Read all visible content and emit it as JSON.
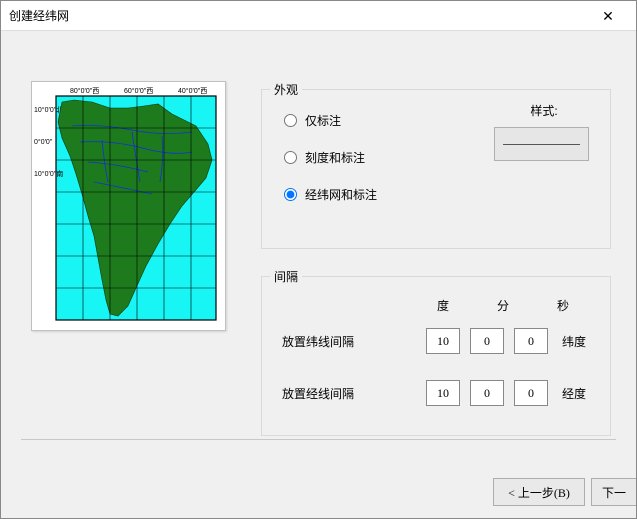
{
  "window": {
    "title": "创建经纬网",
    "close_glyph": "✕"
  },
  "preview": {
    "ticks_top": [
      "80°0'0\"西",
      "60°0'0\"西",
      "40°0'0\"西"
    ],
    "ticks_left": [
      "10°0'0\"北",
      "0°0'0\"",
      "10°0'0\"南"
    ]
  },
  "appearance": {
    "legend": "外观",
    "options": {
      "label_only": "仅标注",
      "ticks_and_labels": "刻度和标注",
      "grid_and_labels": "经纬网和标注"
    },
    "selected": "grid_and_labels",
    "style_label": "样式:"
  },
  "interval": {
    "legend": "间隔",
    "headers": {
      "deg": "度",
      "min": "分",
      "sec": "秒"
    },
    "rows": {
      "lat": {
        "label": "放置纬线间隔",
        "deg": "10",
        "min": "0",
        "sec": "0",
        "unit": "纬度"
      },
      "lon": {
        "label": "放置经线间隔",
        "deg": "10",
        "min": "0",
        "sec": "0",
        "unit": "经度"
      }
    }
  },
  "buttons": {
    "back": "< 上一步(B)",
    "next": "下一"
  }
}
